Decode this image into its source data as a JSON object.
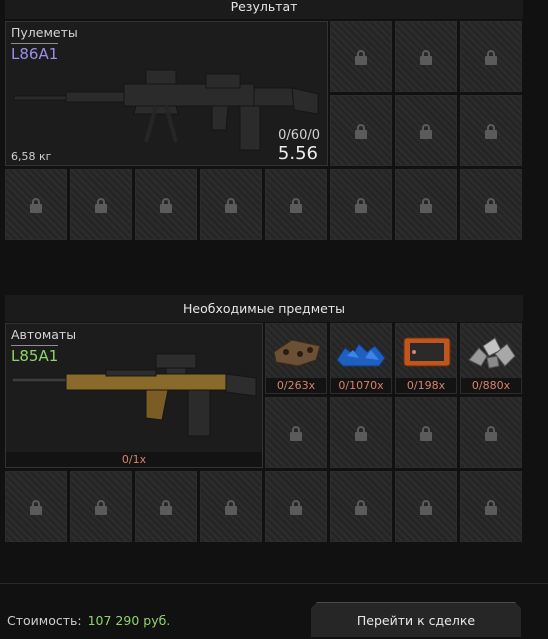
{
  "result": {
    "title": "Результат",
    "weapon": {
      "category": "Пулеметы",
      "name": "L86A1",
      "ammo": "0/60/0",
      "value": "5.56",
      "weight": "6,58 кг",
      "name_color": "#9a90e6"
    }
  },
  "required": {
    "title": "Необходимые предметы",
    "weapon": {
      "category": "Автоматы",
      "name": "L85A1",
      "count": "0/1x",
      "name_color": "#8fd46a"
    },
    "items": [
      {
        "icon": "brown-resource-icon",
        "count": "0/263x"
      },
      {
        "icon": "blue-crystals-icon",
        "count": "0/1070x"
      },
      {
        "icon": "orange-device-icon",
        "count": "0/198x"
      },
      {
        "icon": "metal-scrap-icon",
        "count": "0/880x"
      }
    ]
  },
  "footer": {
    "cost_label": "Стоимость:",
    "cost_value": "107 290 руб.",
    "deal_button": "Перейти к сделке"
  },
  "colors": {
    "accent_green": "#8fd46a",
    "accent_purple": "#9a90e6",
    "count_red": "#d9826c"
  }
}
